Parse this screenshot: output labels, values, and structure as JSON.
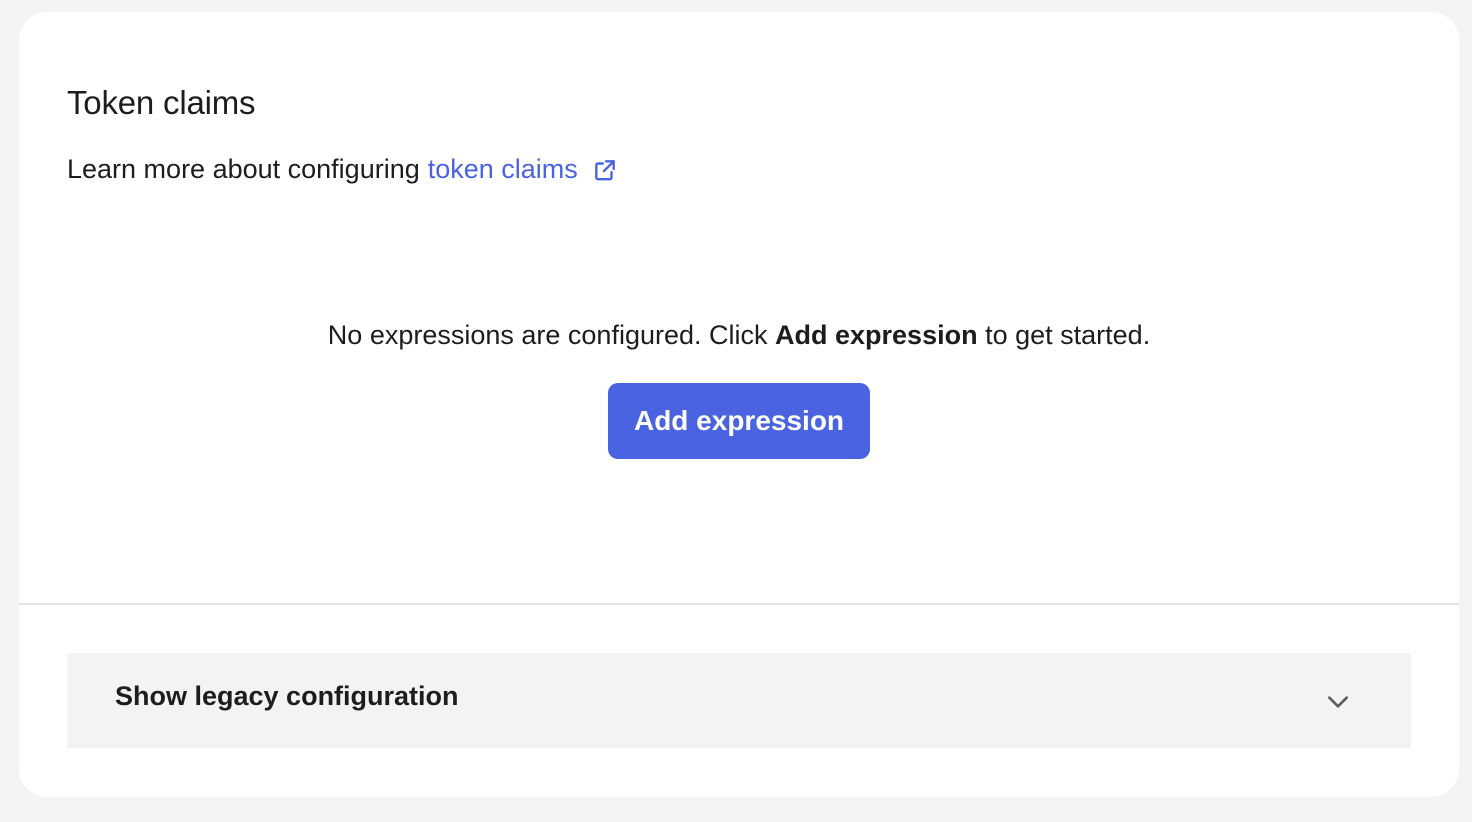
{
  "section": {
    "title": "Token claims",
    "learn_prefix": "Learn more about configuring",
    "learn_link": "token claims"
  },
  "empty_state": {
    "text_before": "No expressions are configured. Click",
    "text_bold": "Add expression",
    "text_after": "to get started.",
    "button_label": "Add expression"
  },
  "legacy": {
    "label": "Show legacy configuration"
  },
  "colors": {
    "accent": "#4a63e0",
    "panel_bg": "#f3f3f3",
    "page_bg": "#f4f4f4"
  },
  "icons": {
    "external_link": "external-link-icon",
    "chevron": "chevron-down-icon"
  }
}
